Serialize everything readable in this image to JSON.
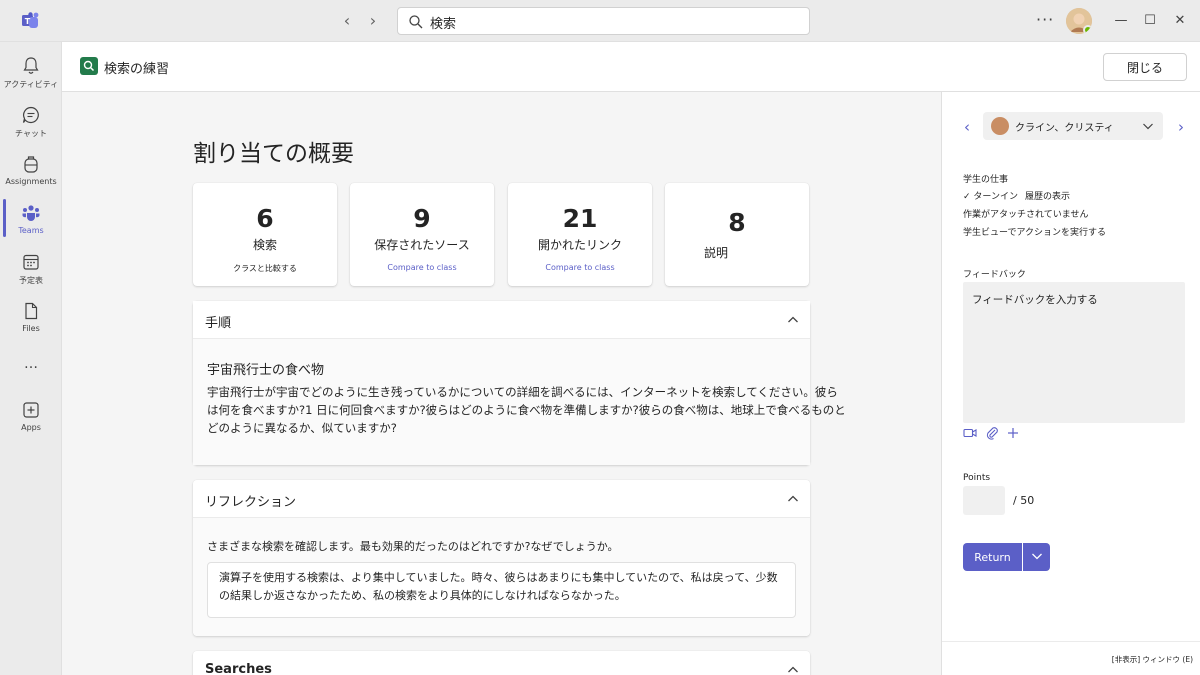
{
  "titlebar": {
    "search_placeholder": "検索"
  },
  "rail": {
    "items": [
      {
        "label": "アクティビティ",
        "icon": "bell-icon"
      },
      {
        "label": "チャット",
        "icon": "chat-icon"
      },
      {
        "label": "Assignments",
        "icon": "backpack-icon"
      },
      {
        "label": "Teams",
        "icon": "teams-icon"
      },
      {
        "label": "予定表",
        "icon": "calendar-icon"
      },
      {
        "label": "Files",
        "icon": "file-icon"
      },
      {
        "label": "Apps",
        "icon": "apps-icon"
      }
    ],
    "more": "…"
  },
  "header": {
    "title": "検索の練習",
    "close_label": "閉じる"
  },
  "main": {
    "page_title": "割り当ての概要",
    "stats": [
      {
        "value": "6",
        "label": "検索",
        "link": "クラスと比較する"
      },
      {
        "value": "9",
        "label": "保存されたソース",
        "link": "Compare to class"
      },
      {
        "value": "21",
        "label": "開かれたリンク",
        "link": "Compare to class"
      },
      {
        "value": "8",
        "label": "説明",
        "link": ""
      }
    ],
    "instructions": {
      "title": "手順",
      "subtitle": "宇宙飛行士の食べ物",
      "text": "宇宙飛行士が宇宙でどのように生き残っているかについての詳細を調べるには、インターネットを検索してください。彼らは何を食べますか?1 日に何回食べますか?彼らはどのように食べ物を準備しますか?彼らの食べ物は、地球上で食べるものとどのように異なるか、似ていますか?"
    },
    "reflection": {
      "title": "リフレクション",
      "question": "さまざまな検索を確認します。最も効果的だったのはどれですか?なぜでしょうか。",
      "answer": "演算子を使用する検索は、より集中していました。時々、彼らはあまりにも集中していたので、私は戻って、少数の結果しか返さなかったため、私の検索をより具体的にしなければならなかった。"
    },
    "searches": {
      "title": "Searches"
    }
  },
  "right_pane": {
    "student_name": "クライン、クリスティ",
    "student_work_label": "学生の仕事",
    "turned_in": "✓ ターンイン",
    "history_link": "履歴の表示",
    "no_attachment": "作業がアタッチされていません",
    "student_view_action": "学生ビューでアクションを実行する",
    "feedback_label": "フィードバック",
    "feedback_placeholder": "フィードバックを入力する",
    "points_label": "Points",
    "points_max": "/ 50",
    "return_label": "Return",
    "footer_text": "[非表示] ウィンドウ (E)"
  },
  "colors": {
    "accent": "#5b5fc7",
    "status_available": "#6bb700",
    "app_icon": "#237b4b"
  }
}
